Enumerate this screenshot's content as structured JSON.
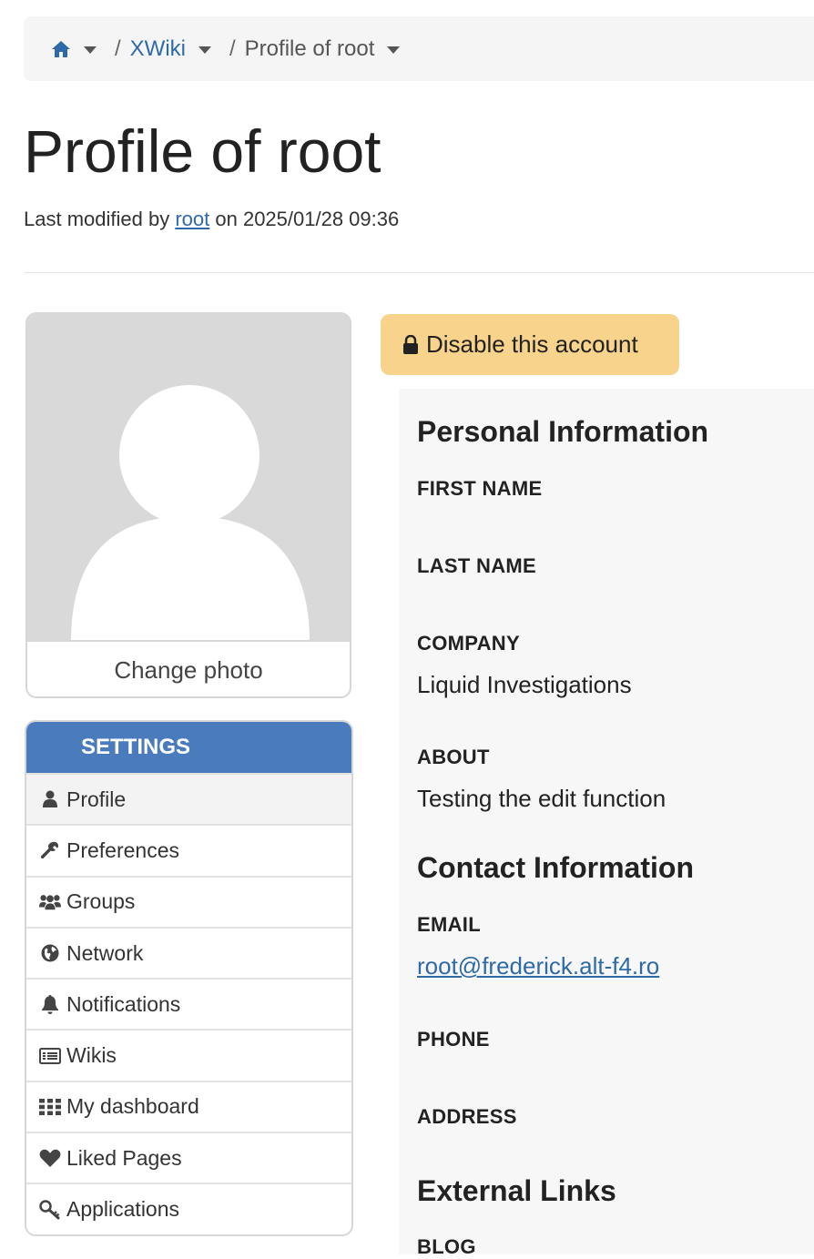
{
  "breadcrumb": {
    "home_icon": "home-icon",
    "sep": "/",
    "items": [
      {
        "label": "XWiki"
      },
      {
        "label": "Profile of root"
      }
    ]
  },
  "page": {
    "title": "Profile of root",
    "meta_prefix": "Last modified by",
    "meta_user": "root",
    "meta_suffix": "on 2025/01/28 09:36"
  },
  "avatar": {
    "change_photo": "Change photo"
  },
  "settings": {
    "header": "SETTINGS",
    "items": [
      {
        "label": "Profile",
        "icon": "user-icon"
      },
      {
        "label": "Preferences",
        "icon": "wrench-icon"
      },
      {
        "label": "Groups",
        "icon": "users-icon"
      },
      {
        "label": "Network",
        "icon": "globe-icon"
      },
      {
        "label": "Notifications",
        "icon": "bell-icon"
      },
      {
        "label": "Wikis",
        "icon": "list-icon"
      },
      {
        "label": "My dashboard",
        "icon": "grid-icon"
      },
      {
        "label": "Liked Pages",
        "icon": "heart-icon"
      },
      {
        "label": "Applications",
        "icon": "key-icon"
      }
    ]
  },
  "actions": {
    "disable_account": "Disable this account"
  },
  "personal": {
    "title": "Personal Information",
    "first_name_label": "FIRST NAME",
    "last_name_label": "LAST NAME",
    "company_label": "COMPANY",
    "company_value": "Liquid Investigations",
    "about_label": "ABOUT",
    "about_value": "Testing the edit function"
  },
  "contact": {
    "title": "Contact Information",
    "email_label": "EMAIL",
    "email_value": "root@frederick.alt-f4.ro",
    "phone_label": "PHONE",
    "address_label": "ADDRESS"
  },
  "external": {
    "title": "External Links",
    "blog_label": "BLOG"
  },
  "colors": {
    "link": "#2f6aa8",
    "settings_header": "#4a7bbd",
    "warning_button": "#f7d38c",
    "panel_bg": "#f7f7f7"
  }
}
